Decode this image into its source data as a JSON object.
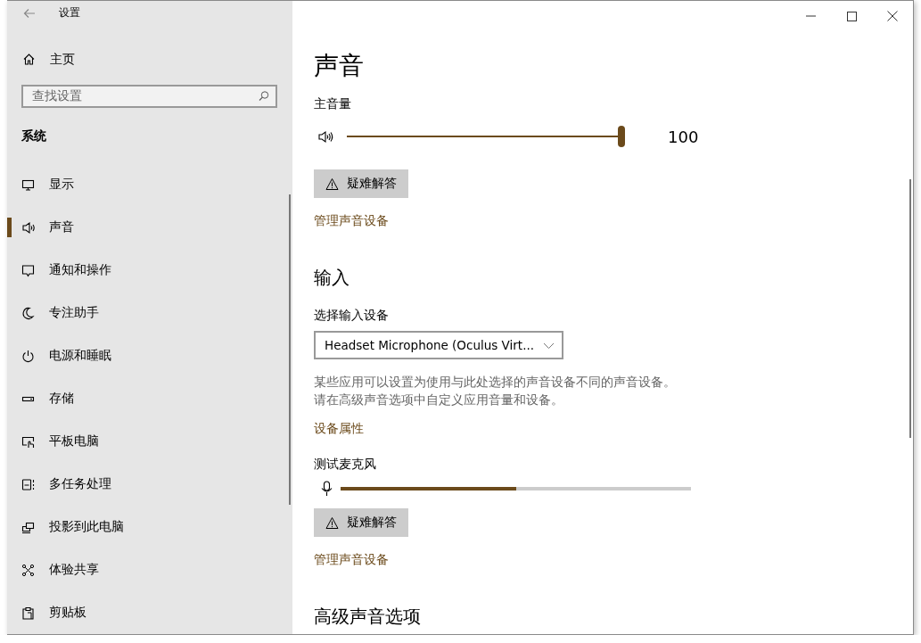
{
  "window": {
    "title": "设置"
  },
  "sidebar": {
    "home": "主页",
    "search": {
      "placeholder": "查找设置"
    },
    "section": "系统",
    "items": [
      {
        "label": "显示",
        "selected": false
      },
      {
        "label": "声音",
        "selected": true
      },
      {
        "label": "通知和操作",
        "selected": false
      },
      {
        "label": "专注助手",
        "selected": false
      },
      {
        "label": "电源和睡眠",
        "selected": false
      },
      {
        "label": "存储",
        "selected": false
      },
      {
        "label": "平板电脑",
        "selected": false
      },
      {
        "label": "多任务处理",
        "selected": false
      },
      {
        "label": "投影到此电脑",
        "selected": false
      },
      {
        "label": "体验共享",
        "selected": false
      },
      {
        "label": "剪贴板",
        "selected": false
      }
    ]
  },
  "content": {
    "title": "声音",
    "master_volume": {
      "label": "主音量",
      "level": 1.0,
      "reading": "100"
    },
    "output_troubleshoot": "疑难解答",
    "output_manage_link": "管理声音设备",
    "input": {
      "heading": "输入",
      "device_label": "选择输入设备",
      "device": "Headset Microphone (Oculus Virt...",
      "description": [
        "某些应用可以设置为使用与此处选择的声音设备不同的声音设备。",
        "请在高级声音选项中自定义应用音量和设备。"
      ],
      "properties_link": "设备属性",
      "test_label": "测试麦克风",
      "mic_level": {
        "level": 0.5
      },
      "troubleshoot": "疑难解答",
      "manage_link": "管理声音设备"
    },
    "advanced_heading": "高级声音选项"
  }
}
